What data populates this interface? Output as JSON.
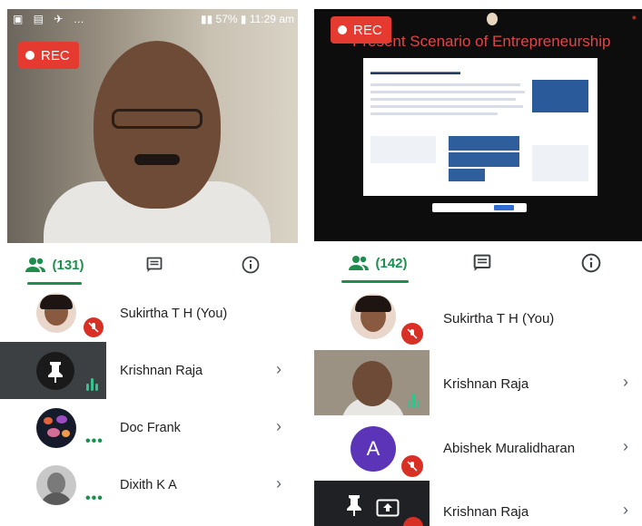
{
  "left": {
    "status_bar": {
      "icons_left": "▣ ▤ ✈ …",
      "battery": "57%",
      "time": "11:29 am"
    },
    "rec_label": "REC",
    "tabs": {
      "people_count": "(131)"
    },
    "participants": [
      {
        "name": "Sukirtha T H (You)"
      },
      {
        "name": "Krishnan Raja"
      },
      {
        "name": "Doc Frank"
      },
      {
        "name": "Dixith K A"
      }
    ]
  },
  "right": {
    "rec_label": "REC",
    "slide_title": "Present Scenario of Entrepreneurship",
    "tabs": {
      "people_count": "(142)"
    },
    "participants": [
      {
        "name": "Sukirtha T H (You)"
      },
      {
        "name": "Krishnan Raja"
      },
      {
        "name": "Abishek Muralidharan",
        "avatar_letter": "A"
      },
      {
        "name": "Krishnan Raja"
      }
    ]
  },
  "colors": {
    "accent_green": "#1e8e4e",
    "rec_red": "#e43a2f",
    "mute_red": "#d93025",
    "avatar_purple": "#5b34b8"
  }
}
